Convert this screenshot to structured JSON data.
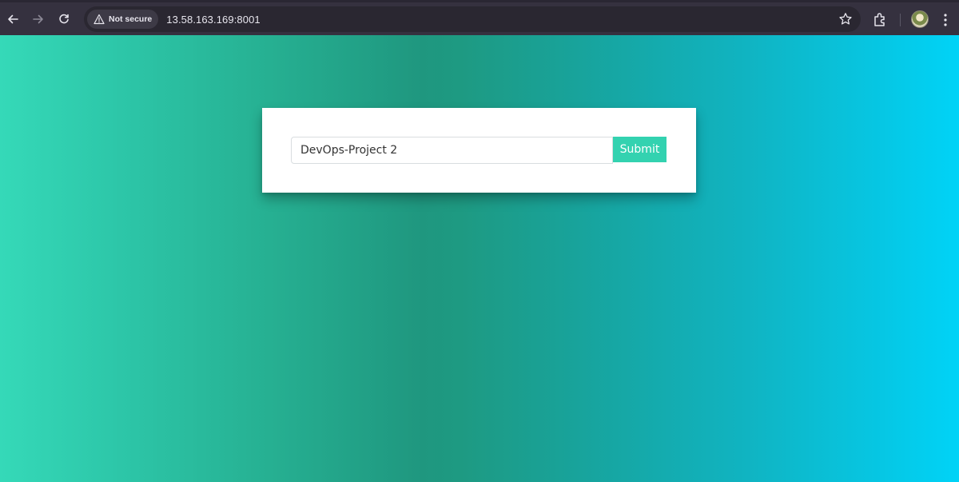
{
  "browser": {
    "security_label": "Not secure",
    "url": "13.58.163.169:8001"
  },
  "page": {
    "input_value": "DevOps-Project 2",
    "submit_label": "Submit"
  },
  "colors": {
    "toolbar": "#35313f",
    "omnibox": "#2a2731",
    "gradient_left": "#35d9b8",
    "gradient_mid": "#1f977f",
    "gradient_right": "#00d3f7",
    "button": "#33d2b0"
  }
}
